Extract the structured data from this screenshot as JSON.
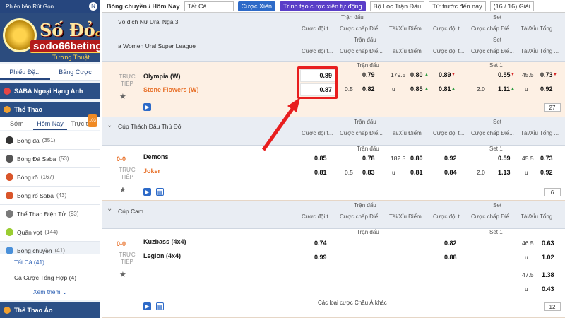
{
  "sidebar": {
    "top_label": "Phiên bản Rút Gọn",
    "top_badge": "N",
    "logo_title": "Số Đỏ",
    "logo_casino": "casino",
    "logo_site": "sodo66beting.com",
    "logo_tag": "Tương Thuật",
    "tabs": [
      "Phiếu Đặ...",
      "Bảng Cược"
    ],
    "league_section": "SABA Ngoại Hạng Anh",
    "sports_section": "Thể Thao",
    "subtabs": [
      "Sớm",
      "Hôm Nay",
      "Trực tiếp"
    ],
    "live_badge": "103",
    "sports": [
      {
        "name": "Bóng đá",
        "count": "(351)"
      },
      {
        "name": "Bóng Đá Saba",
        "count": "(53)"
      },
      {
        "name": "Bóng rổ",
        "count": "(167)"
      },
      {
        "name": "Bóng rổ Saba",
        "count": "(43)"
      },
      {
        "name": "Thể Thao Điện Tử",
        "count": "(93)"
      },
      {
        "name": "Quần vợt",
        "count": "(144)"
      },
      {
        "name": "Bóng chuyền",
        "count": "(41)"
      }
    ],
    "subitems": [
      {
        "name": "Tất Cả",
        "count": "(41)"
      },
      {
        "name": "Cá Cược Tổng Hợp",
        "count": "(4)"
      }
    ],
    "more": "Xem thêm",
    "virtual_section": "Thể Thao Ảo"
  },
  "toolbar": {
    "breadcrumb": "Bóng chuyền / Hôm Nay",
    "filter_all": "Tất Cả",
    "parlay": "Cược Xiên",
    "auto": "Trình tạo cược xiên tự động",
    "league_filter": "Bộ Lọc Trận Đấu",
    "sort": "Từ trước đến nay",
    "pages": "(16 / 16) Giải"
  },
  "columns": {
    "match_group": "Trận đấu",
    "set_group": "Set",
    "set1": "Set 1",
    "h1": "Cược đội t...",
    "h2": "Cược chấp Điể...",
    "h3": "Tài/Xỉu Điểm",
    "h4": "Cược đội t...",
    "h5": "Cược chấp Điể...",
    "h6": "Tài/Xỉu Tổng ..."
  },
  "groups": [
    {
      "name": "Vô địch Nữ Ural Nga 3",
      "subname": "a Women Ural Super League"
    },
    {
      "name": "Cúp Thách Đấu Thủ Đô"
    },
    {
      "name": "Cúp Cam"
    }
  ],
  "matches": [
    {
      "status": "TRỰC TIẾP",
      "score": "",
      "home": "Olympia (W)",
      "away": "Stone Flowers (W)",
      "odds": [
        "0.89",
        "0.79",
        "179.5",
        "0.80",
        "0.89",
        "0.55",
        "45.5",
        "0.73",
        "0.87",
        "0.5",
        "0.82",
        "u",
        "0.85",
        "0.81",
        "2.0",
        "1.11",
        "u",
        "0.92"
      ],
      "more": "27"
    },
    {
      "status": "TRỰC TIẾP",
      "score": "0-0",
      "home": "Demons",
      "away": "Joker",
      "odds": [
        "0.85",
        "0.78",
        "182.5",
        "0.80",
        "0.92",
        "0.59",
        "45.5",
        "0.73",
        "0.81",
        "0.5",
        "0.83",
        "u",
        "0.81",
        "0.84",
        "2.0",
        "1.13",
        "u",
        "0.92"
      ],
      "more": "6"
    },
    {
      "status": "TRỰC TIẾP",
      "score": "0-0",
      "home": "Kuzbass (4x4)",
      "away": "Legion (4x4)",
      "odds": [
        "0.74",
        "0.82",
        "46.5",
        "0.63",
        "0.99",
        "0.88",
        "u",
        "1.02",
        "47.5",
        "1.38",
        "u",
        "0.43"
      ],
      "more": "12",
      "other": "Các loại cược Châu Á khác"
    }
  ]
}
